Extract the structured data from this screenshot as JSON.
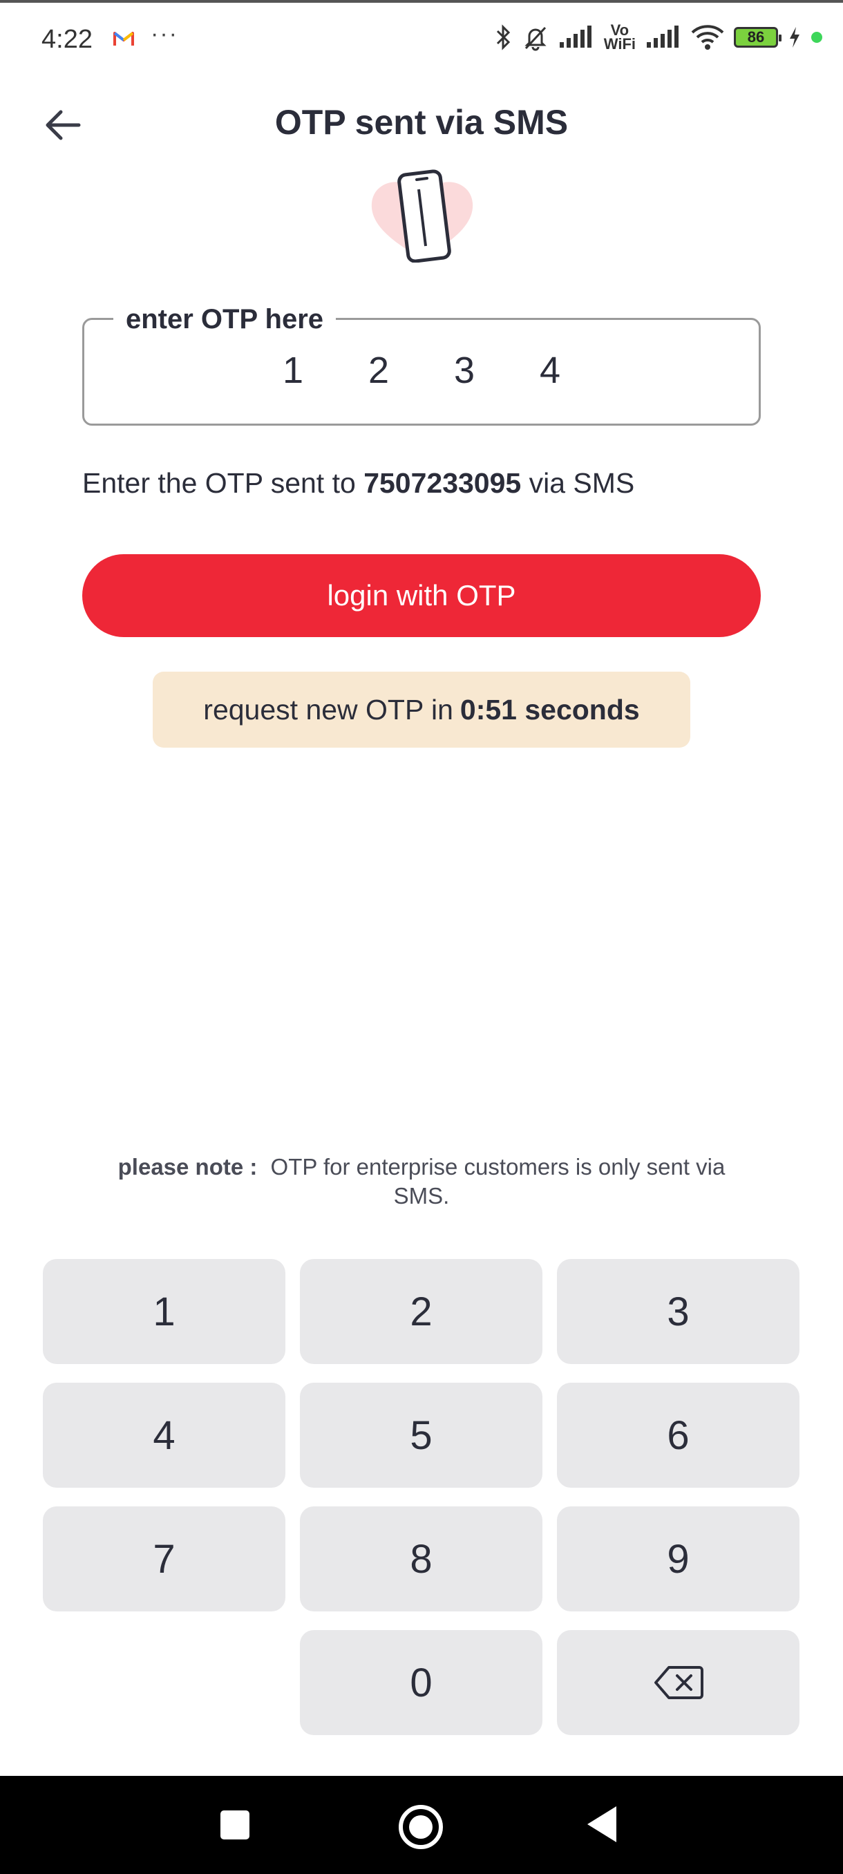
{
  "status_bar": {
    "time": "4:22",
    "more": "···",
    "vowifi_top": "Vo",
    "vowifi_bottom": "WiFi",
    "battery": "86"
  },
  "header": {
    "title": "OTP sent via SMS"
  },
  "otp": {
    "label": "enter OTP here",
    "digits": [
      "1",
      "2",
      "3",
      "4"
    ]
  },
  "info": {
    "prefix": "Enter the OTP sent to ",
    "phone": "7507233095",
    "suffix": " via SMS"
  },
  "login_button": "login with OTP",
  "timer": {
    "prefix": "request new OTP in",
    "value": "0:51 seconds"
  },
  "note": {
    "label": "please note :",
    "text": "OTP for enterprise customers is only sent via SMS."
  },
  "keypad": {
    "keys": [
      "1",
      "2",
      "3",
      "4",
      "5",
      "6",
      "7",
      "8",
      "9",
      "0"
    ]
  },
  "colors": {
    "accent": "#ee2737",
    "timer_bg": "#f8e8d1",
    "key_bg": "#e8e8ea",
    "text": "#2b2d3a"
  }
}
